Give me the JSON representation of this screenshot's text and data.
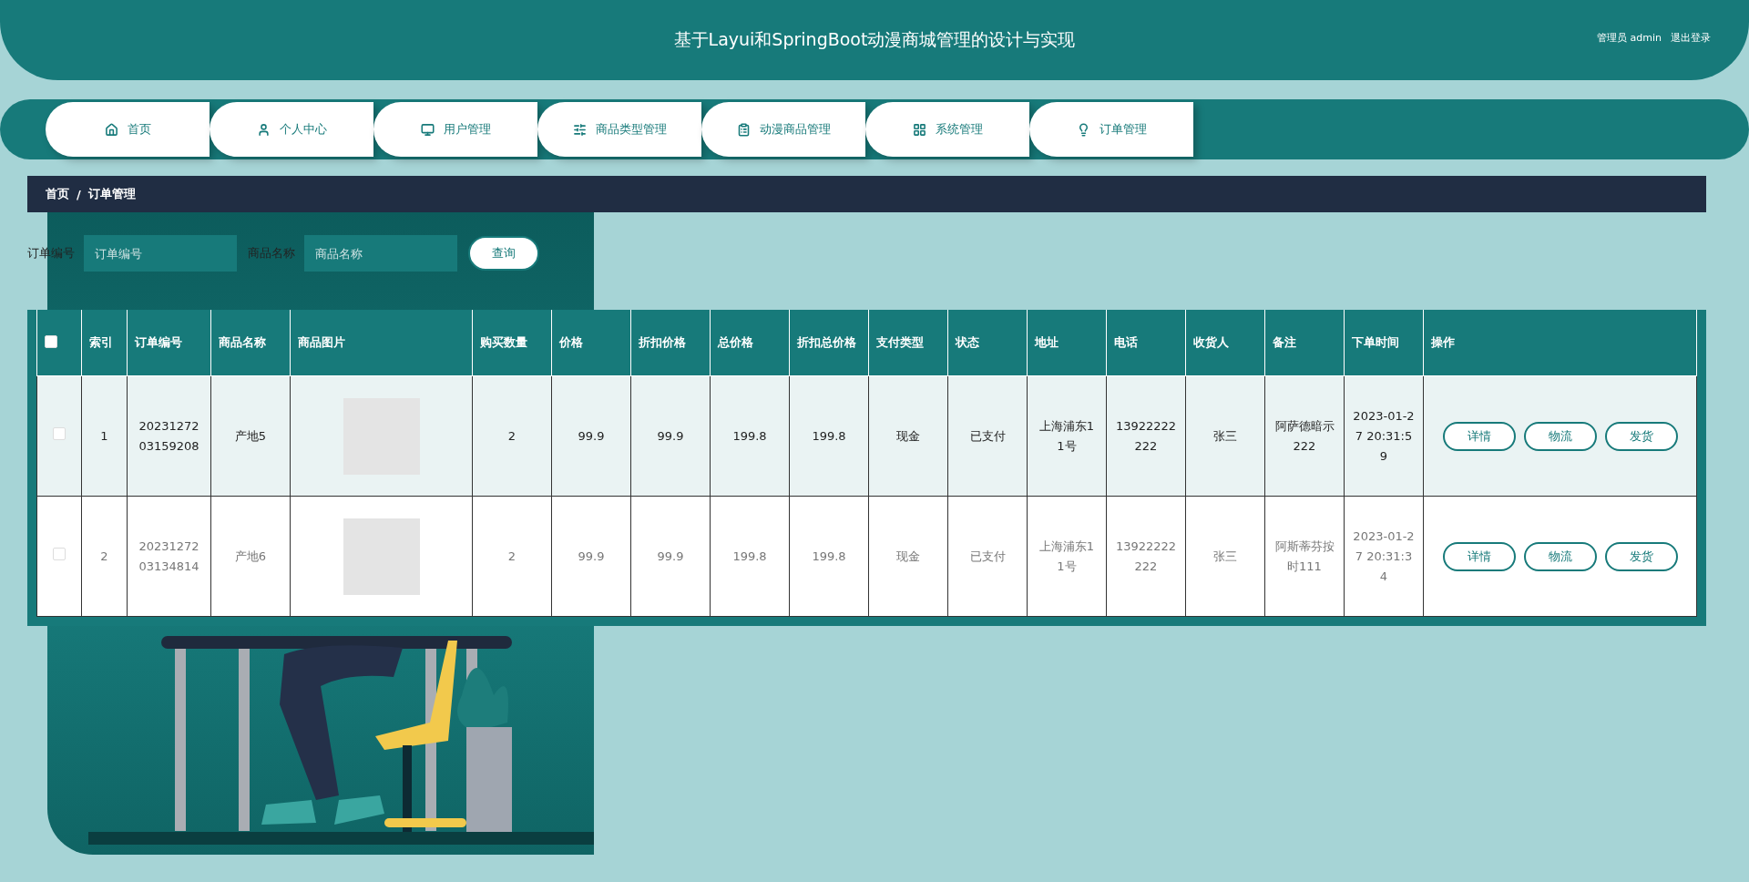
{
  "header": {
    "title": "基于Layui和SpringBoot动漫商城管理的设计与实现",
    "user": "管理员 admin",
    "logout": "退出登录"
  },
  "nav": [
    {
      "label": "首页",
      "selected": false
    },
    {
      "label": "个人中心",
      "selected": false
    },
    {
      "label": "用户管理",
      "selected": false
    },
    {
      "label": "商品类型管理",
      "selected": false
    },
    {
      "label": "动漫商品管理",
      "selected": false
    },
    {
      "label": "系统管理",
      "selected": false
    },
    {
      "label": "订单管理",
      "selected": false
    }
  ],
  "breadcrumb": {
    "items": [
      "首页",
      "订单管理"
    ],
    "separator": "/"
  },
  "search": {
    "fields": [
      {
        "label": "订单编号",
        "placeholder": "订单编号"
      },
      {
        "label": "商品名称",
        "placeholder": "商品名称"
      }
    ],
    "button": "查询"
  },
  "table": {
    "select_all": {
      "checked": false
    },
    "columns": [
      "索引",
      "订单编号",
      "商品名称",
      "商品图片",
      "购买数量",
      "价格",
      "折扣价格",
      "总价格",
      "折扣总价格",
      "支付类型",
      "状态",
      "地址",
      "电话",
      "收货人",
      "备注",
      "下单时间",
      "操作"
    ],
    "rows": [
      {
        "checked": false,
        "highlighted": true,
        "cells": [
          "1",
          "2023127203159208",
          "产地5",
          null,
          "2",
          "99.9",
          "99.9",
          "199.8",
          "199.8",
          "现金",
          "已支付",
          "上海浦东11号",
          "13922222222",
          "张三",
          "阿萨德暗示222",
          "2023-01-27 20:31:59"
        ],
        "actions": [
          "详情",
          "物流",
          "发货"
        ]
      },
      {
        "checked": false,
        "highlighted": false,
        "cells": [
          "2",
          "2023127203134814",
          "产地6",
          null,
          "2",
          "99.9",
          "99.9",
          "199.8",
          "199.8",
          "现金",
          "已支付",
          "上海浦东11号",
          "13922222222",
          "张三",
          "阿斯蒂芬按时111",
          "2023-01-27 20:31:34"
        ],
        "actions": [
          "详情",
          "物流",
          "发货"
        ]
      }
    ]
  }
}
